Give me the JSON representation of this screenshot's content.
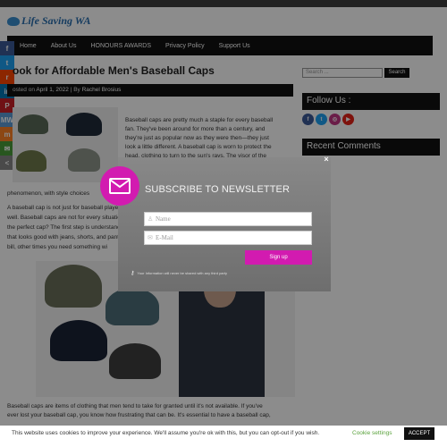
{
  "site": {
    "logo_text": "Life Saving WA"
  },
  "nav": {
    "items": [
      "Home",
      "About Us",
      "HONOURS AWARDS",
      "Privacy Policy",
      "Support Us"
    ]
  },
  "share": {
    "buttons": [
      {
        "icon": "facebook-icon",
        "label": "f",
        "color": "#3b5998"
      },
      {
        "icon": "twitter-icon",
        "label": "t",
        "color": "#1da1f2"
      },
      {
        "icon": "reddit-icon",
        "label": "r",
        "color": "#ff4500"
      },
      {
        "icon": "linkedin-icon",
        "label": "in",
        "color": "#0077b5"
      },
      {
        "icon": "pinterest-icon",
        "label": "P",
        "color": "#cb2027"
      },
      {
        "icon": "mix-icon",
        "label": "MW",
        "color": "#5b9bd5"
      },
      {
        "icon": "mix-icon-2",
        "label": "m",
        "color": "#ff8226"
      },
      {
        "icon": "email-share-icon",
        "label": "✉",
        "color": "#4a9d3a"
      },
      {
        "icon": "more-share-icon",
        "label": "<",
        "color": "#888888"
      }
    ]
  },
  "post": {
    "title": "ook for Affordable Men's Baseball Caps",
    "meta_prefix": "osted on",
    "meta_date": "April 1, 2022",
    "meta_by": "| By",
    "meta_author": "Rachel Brosius",
    "intro_lines": [
      "Baseball caps are pretty much a staple for every baseball",
      "fan. They've been around for more than a century, and",
      "they're just as popular now as they were then—they just",
      "look a little different. A baseball cap is worn to protect the",
      "head, clothing to turn to the sun's rays. The visor of the"
    ],
    "para_line": "phenomenon, with style choices",
    "body_lines": [
      "A baseball cap is not just for baseball players",
      "well. Baseball caps are not for every situation",
      "the perfect cap? The first step is understanding",
      "that looks good with jeans, shorts, and pants",
      "bill, other times you need something wi"
    ],
    "footer_lines": [
      "Baseball caps are items of clothing that men tend to take for granted until it's not available. If you've",
      "ever lost your baseball cap, you know how frustrating that can be. It's essential to have a baseball cap,"
    ]
  },
  "sidebar": {
    "search_placeholder": "Search ...",
    "search_button": "Search",
    "follow_title": "Follow Us :",
    "follow_icons": [
      {
        "name": "facebook-icon",
        "label": "f",
        "color": "#3b5998"
      },
      {
        "name": "twitter-icon",
        "label": "t",
        "color": "#1da1f2"
      },
      {
        "name": "instagram-icon",
        "label": "◎",
        "color": "#c13584"
      },
      {
        "name": "youtube-icon",
        "label": "▶",
        "color": "#e62117"
      }
    ],
    "comments_title": "Recent Comments"
  },
  "modal": {
    "heading": "SUBSCRIBE TO NEWSLETTER",
    "name_placeholder": "Name",
    "email_placeholder": "E-Mail",
    "signup_label": "Sign up",
    "privacy_text": "Your Information will never be shared with any third party",
    "close_label": "×"
  },
  "cookie": {
    "text": "This website uses cookies to improve your experience. We'll assume you're ok with this, but you can opt-out if you wish.",
    "settings_label": "Cookie settings",
    "accept_label": "ACCEPT"
  },
  "colors": {
    "accent": "#d21bb0",
    "nav_bg": "#111111",
    "cookie_link": "#5aa23c"
  }
}
